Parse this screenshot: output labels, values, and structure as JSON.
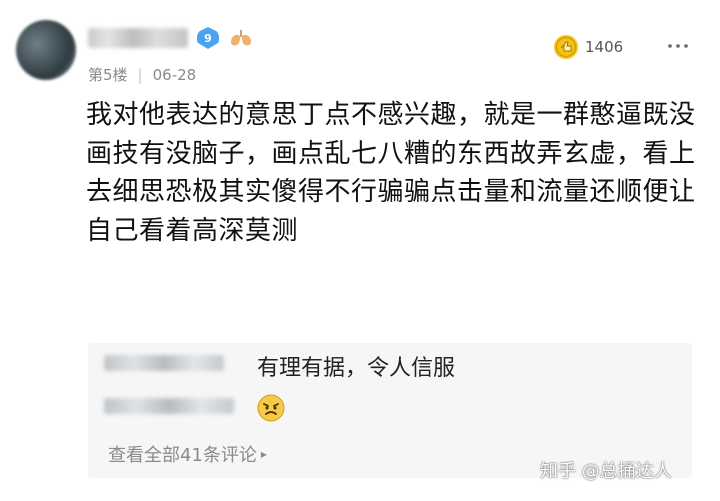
{
  "post": {
    "floor": "第5楼",
    "date": "06-28",
    "level": "9",
    "like_count": "1406",
    "text": "我对他表达的意思丁点不感兴趣，就是一群憨逼既没画技有没脑子，画点乱七八糟的东西故弄玄虚，看上去细思恐极其实傻得不行骗骗点击量和流量还顺便让自己看着高深莫测"
  },
  "reply": {
    "text": "有理有据，令人信服",
    "emoji": "angry-face"
  },
  "view_all": "查看全部41条评论",
  "watermark": "知乎 @总捅达人",
  "icons": {
    "level": "level-badge-icon",
    "lung": "lung-icon",
    "like": "like-icon",
    "more": "more-icon",
    "reply_emoji": "angry-emoji-icon",
    "arrow": "chevron-right-icon"
  },
  "colors": {
    "level_badge": "#4aa3f0",
    "like": "#f4c21a",
    "meta": "#8a8a8a",
    "reply_bg": "#f6f6f6"
  }
}
